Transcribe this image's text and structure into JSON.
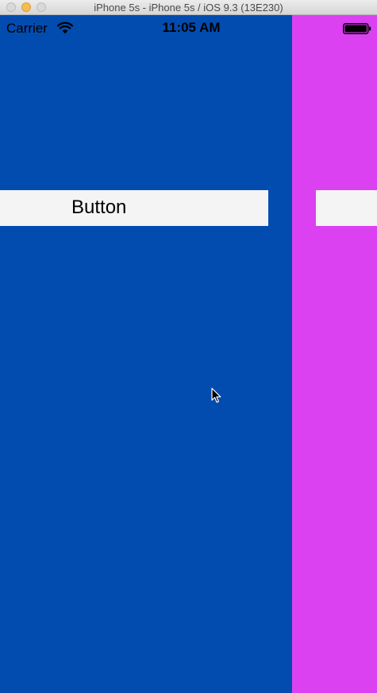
{
  "window": {
    "title": "iPhone 5s - iPhone 5s / iOS 9.3 (13E230)"
  },
  "statusbar": {
    "carrier": "Carrier",
    "time": "11:05 AM",
    "wifi_icon": "wifi-icon",
    "battery_icon": "battery-icon"
  },
  "pages": {
    "current_color": "#024cb0",
    "next_color": "#db41f0"
  },
  "main": {
    "button_label": "Button"
  },
  "pointer": {
    "icon": "mouse-cursor-icon"
  }
}
